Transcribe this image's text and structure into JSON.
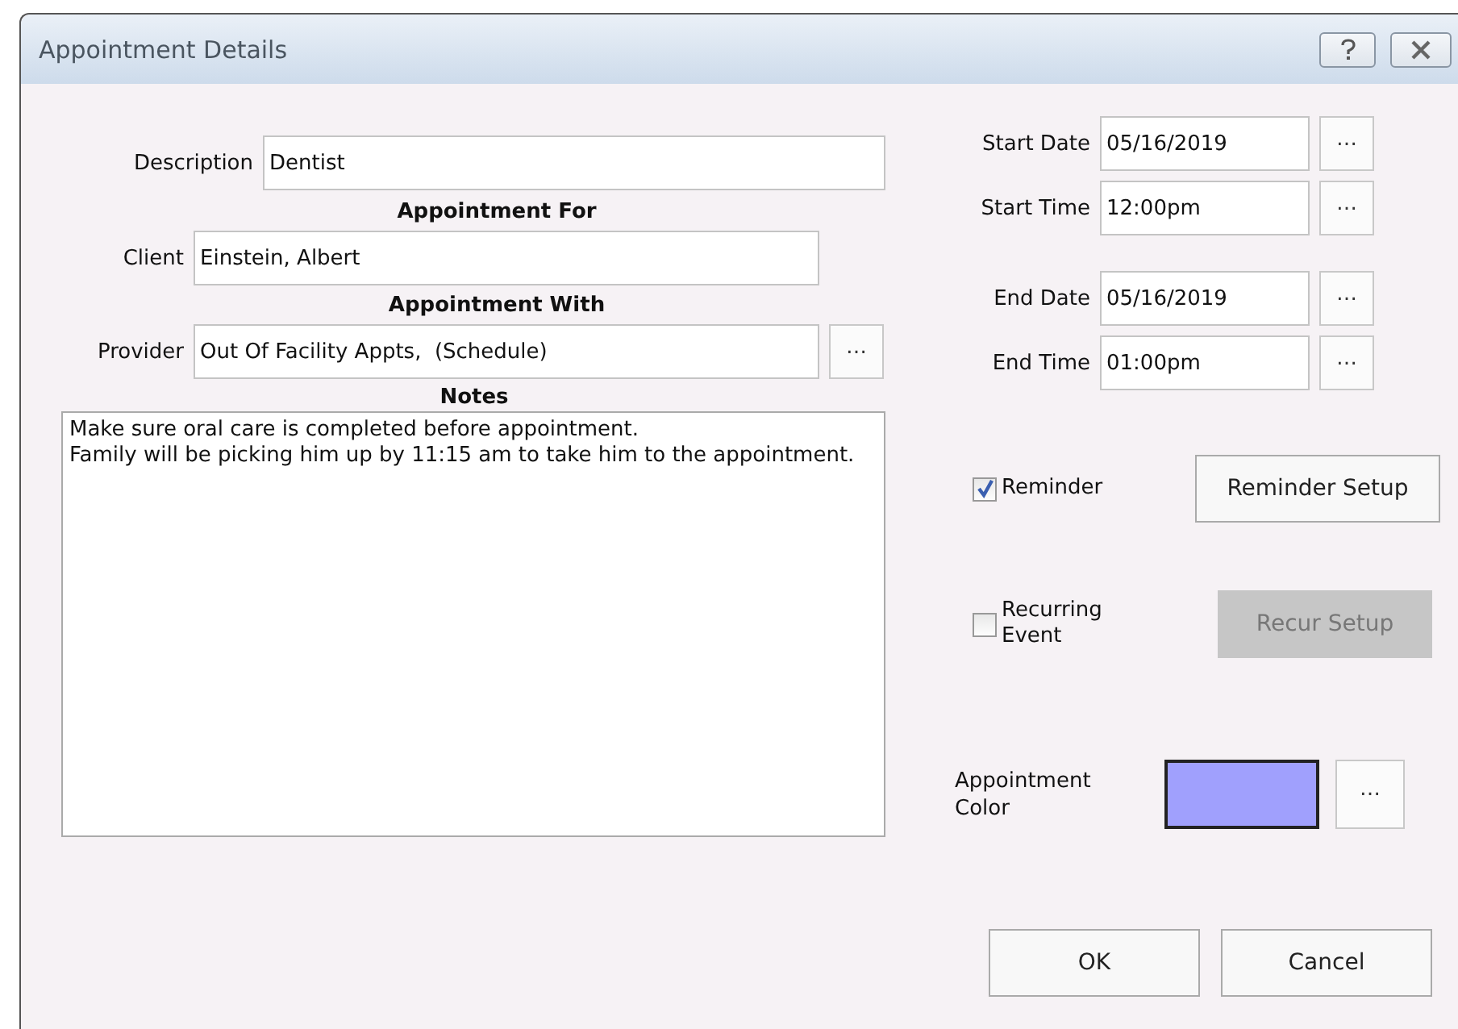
{
  "window": {
    "title": "Appointment Details"
  },
  "description": {
    "label": "Description",
    "value": "Dentist"
  },
  "appointment_for": {
    "heading": "Appointment For",
    "label": "Client",
    "value": "Einstein, Albert"
  },
  "appointment_with": {
    "heading": "Appointment With",
    "label": "Provider",
    "value": "Out Of Facility Appts,  (Schedule)",
    "button": "…"
  },
  "notes": {
    "heading": "Notes",
    "value": "Make sure oral care is completed before appointment.\nFamily will be picking him up by 11:15 am to take him to the appointment."
  },
  "schedule": [
    {
      "label": "Start Date",
      "value": "05/16/2019",
      "button": "…"
    },
    {
      "label": "Start Time",
      "value": "12:00pm",
      "button": "…"
    },
    {
      "label": "End Date",
      "value": "05/16/2019",
      "button": "…"
    },
    {
      "label": "End Time",
      "value": "01:00pm",
      "button": "…"
    }
  ],
  "options": [
    {
      "label": "Reminder",
      "checked": true,
      "button": {
        "label": "Reminder Setup",
        "disabled": false
      }
    },
    {
      "label": "Recurring Event",
      "checked": false,
      "button": {
        "label": "Recur Setup",
        "disabled": true
      }
    }
  ],
  "appointment_color": {
    "label": "Appointment Color",
    "color": "#a0a0fd",
    "button": "…"
  },
  "buttons": [
    {
      "label": "OK"
    },
    {
      "label": "Cancel"
    }
  ]
}
